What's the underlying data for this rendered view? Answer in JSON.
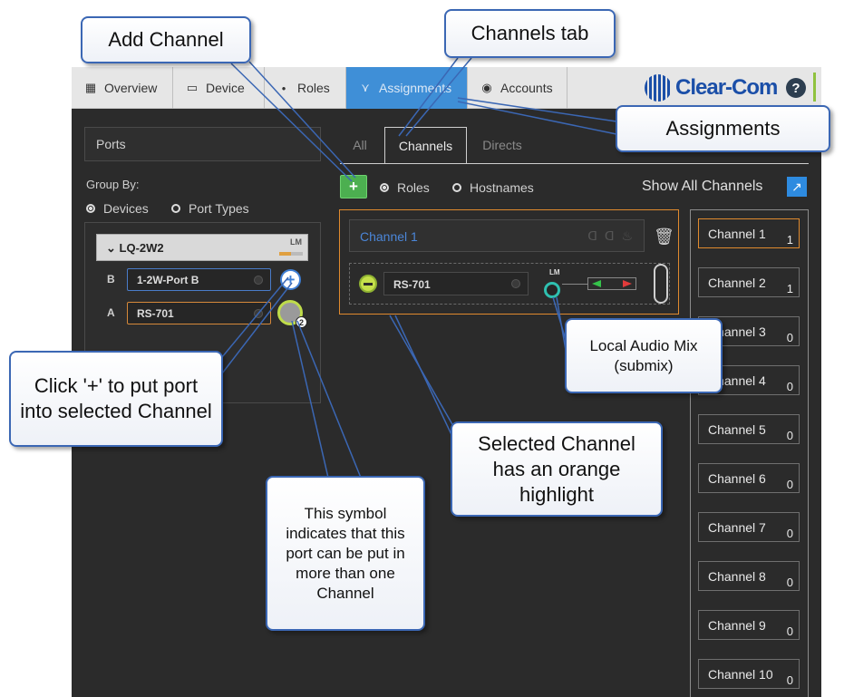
{
  "nav": {
    "tabs": [
      {
        "label": "Overview",
        "icon": "grid-icon"
      },
      {
        "label": "Device",
        "icon": "device-icon"
      },
      {
        "label": "Roles",
        "icon": "roles-icon"
      },
      {
        "label": "Assignments",
        "icon": "assignments-icon",
        "active": true
      },
      {
        "label": "Accounts",
        "icon": "accounts-icon"
      }
    ],
    "brand": "Clear-Com",
    "help": "?"
  },
  "left": {
    "ports_label": "Ports",
    "group_by": "Group By:",
    "options": [
      "Devices",
      "Port Types"
    ],
    "device": {
      "name": "LQ-2W2",
      "tag": "LM"
    },
    "ports": [
      {
        "letter": "B",
        "name": "1-2W-Port B"
      },
      {
        "letter": "A",
        "name": "RS-701"
      }
    ],
    "plus": "+",
    "multi_count": "2"
  },
  "tabs": [
    "All",
    "Channels",
    "Directs"
  ],
  "toolbar": {
    "add": "+",
    "options": [
      "Roles",
      "Hostnames"
    ],
    "show_all": "Show All Channels",
    "show_all_icon": "↗"
  },
  "card": {
    "title": "Channel 1",
    "port": "RS-701",
    "lm": "LM",
    "header_icons": "ᗡ ᗡ ♨",
    "trash": "🗑"
  },
  "channels": [
    {
      "name": "Channel 1",
      "count": "1"
    },
    {
      "name": "Channel 2",
      "count": "1"
    },
    {
      "name": "Channel 3",
      "count": "0"
    },
    {
      "name": "Channel 4",
      "count": "0"
    },
    {
      "name": "Channel 5",
      "count": "0"
    },
    {
      "name": "Channel 6",
      "count": "0"
    },
    {
      "name": "Channel 7",
      "count": "0"
    },
    {
      "name": "Channel 8",
      "count": "0"
    },
    {
      "name": "Channel 9",
      "count": "0"
    },
    {
      "name": "Channel 10",
      "count": "0"
    }
  ],
  "callouts": {
    "add_channel": "Add Channel",
    "channels_tab": "Channels tab",
    "assignments": "Assignments",
    "click_plus": "Click '+' to put port into selected Channel",
    "symbol": "This symbol indicates that this port can be put in more than one Channel",
    "lam": "Local Audio Mix (submix)",
    "selected": "Selected Channel has an orange highlight"
  },
  "colors": {
    "accent_blue": "#3f8fd7",
    "highlight_orange": "#e08a2e",
    "add_green": "#4caf50"
  }
}
